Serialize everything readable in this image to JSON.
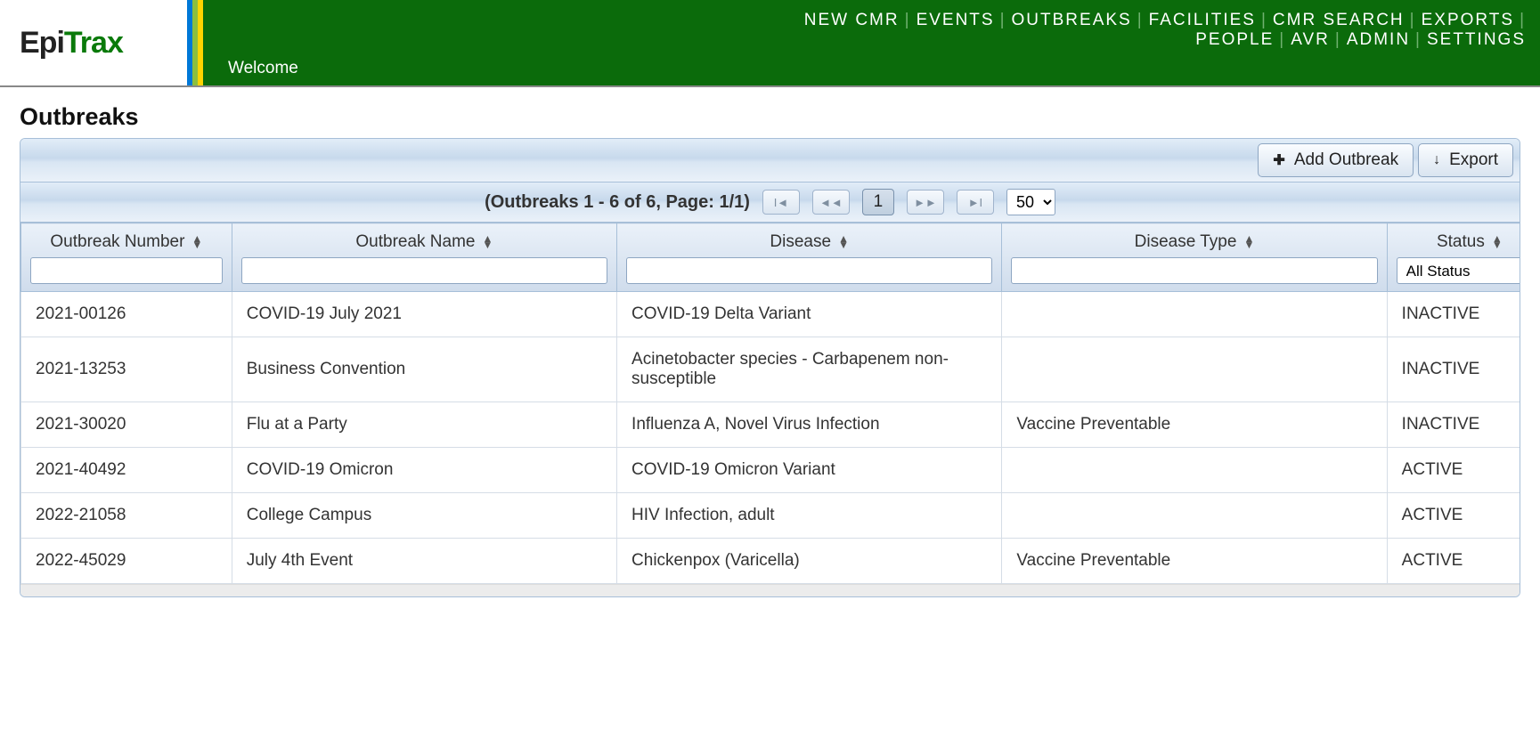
{
  "logo": {
    "part1": "Epi",
    "part2": "Trax"
  },
  "nav": {
    "row1": [
      "NEW CMR",
      "EVENTS",
      "OUTBREAKS",
      "FACILITIES",
      "CMR SEARCH",
      "EXPORTS"
    ],
    "row2": [
      "PEOPLE",
      "AVR",
      "ADMIN",
      "SETTINGS"
    ]
  },
  "welcome": "Welcome",
  "page_title": "Outbreaks",
  "toolbar": {
    "add_label": "Add Outbreak",
    "export_label": "Export"
  },
  "pager": {
    "summary": "(Outbreaks 1 - 6 of 6, Page: 1/1)",
    "current_page": "1",
    "page_size": "50"
  },
  "columns": [
    {
      "key": "number",
      "label": "Outbreak Number",
      "filter": "text"
    },
    {
      "key": "name",
      "label": "Outbreak Name",
      "filter": "text"
    },
    {
      "key": "disease",
      "label": "Disease",
      "filter": "text"
    },
    {
      "key": "dtype",
      "label": "Disease Type",
      "filter": "text"
    },
    {
      "key": "status",
      "label": "Status",
      "filter": "select",
      "selected": "All Status"
    }
  ],
  "rows": [
    {
      "number": "2021-00126",
      "name": "COVID-19 July 2021",
      "disease": "COVID-19 Delta Variant",
      "dtype": "",
      "status": "INACTIVE"
    },
    {
      "number": "2021-13253",
      "name": "Business Convention",
      "disease": "Acinetobacter species - Carbapenem non-susceptible",
      "dtype": "",
      "status": "INACTIVE"
    },
    {
      "number": "2021-30020",
      "name": "Flu at a Party",
      "disease": "Influenza A, Novel Virus Infection",
      "dtype": "Vaccine Preventable",
      "status": "INACTIVE"
    },
    {
      "number": "2021-40492",
      "name": "COVID-19 Omicron",
      "disease": "COVID-19 Omicron Variant",
      "dtype": "",
      "status": "ACTIVE"
    },
    {
      "number": "2022-21058",
      "name": "College Campus",
      "disease": "HIV Infection, adult",
      "dtype": "",
      "status": "ACTIVE"
    },
    {
      "number": "2022-45029",
      "name": "July 4th Event",
      "disease": "Chickenpox (Varicella)",
      "dtype": "Vaccine Preventable",
      "status": "ACTIVE"
    }
  ]
}
